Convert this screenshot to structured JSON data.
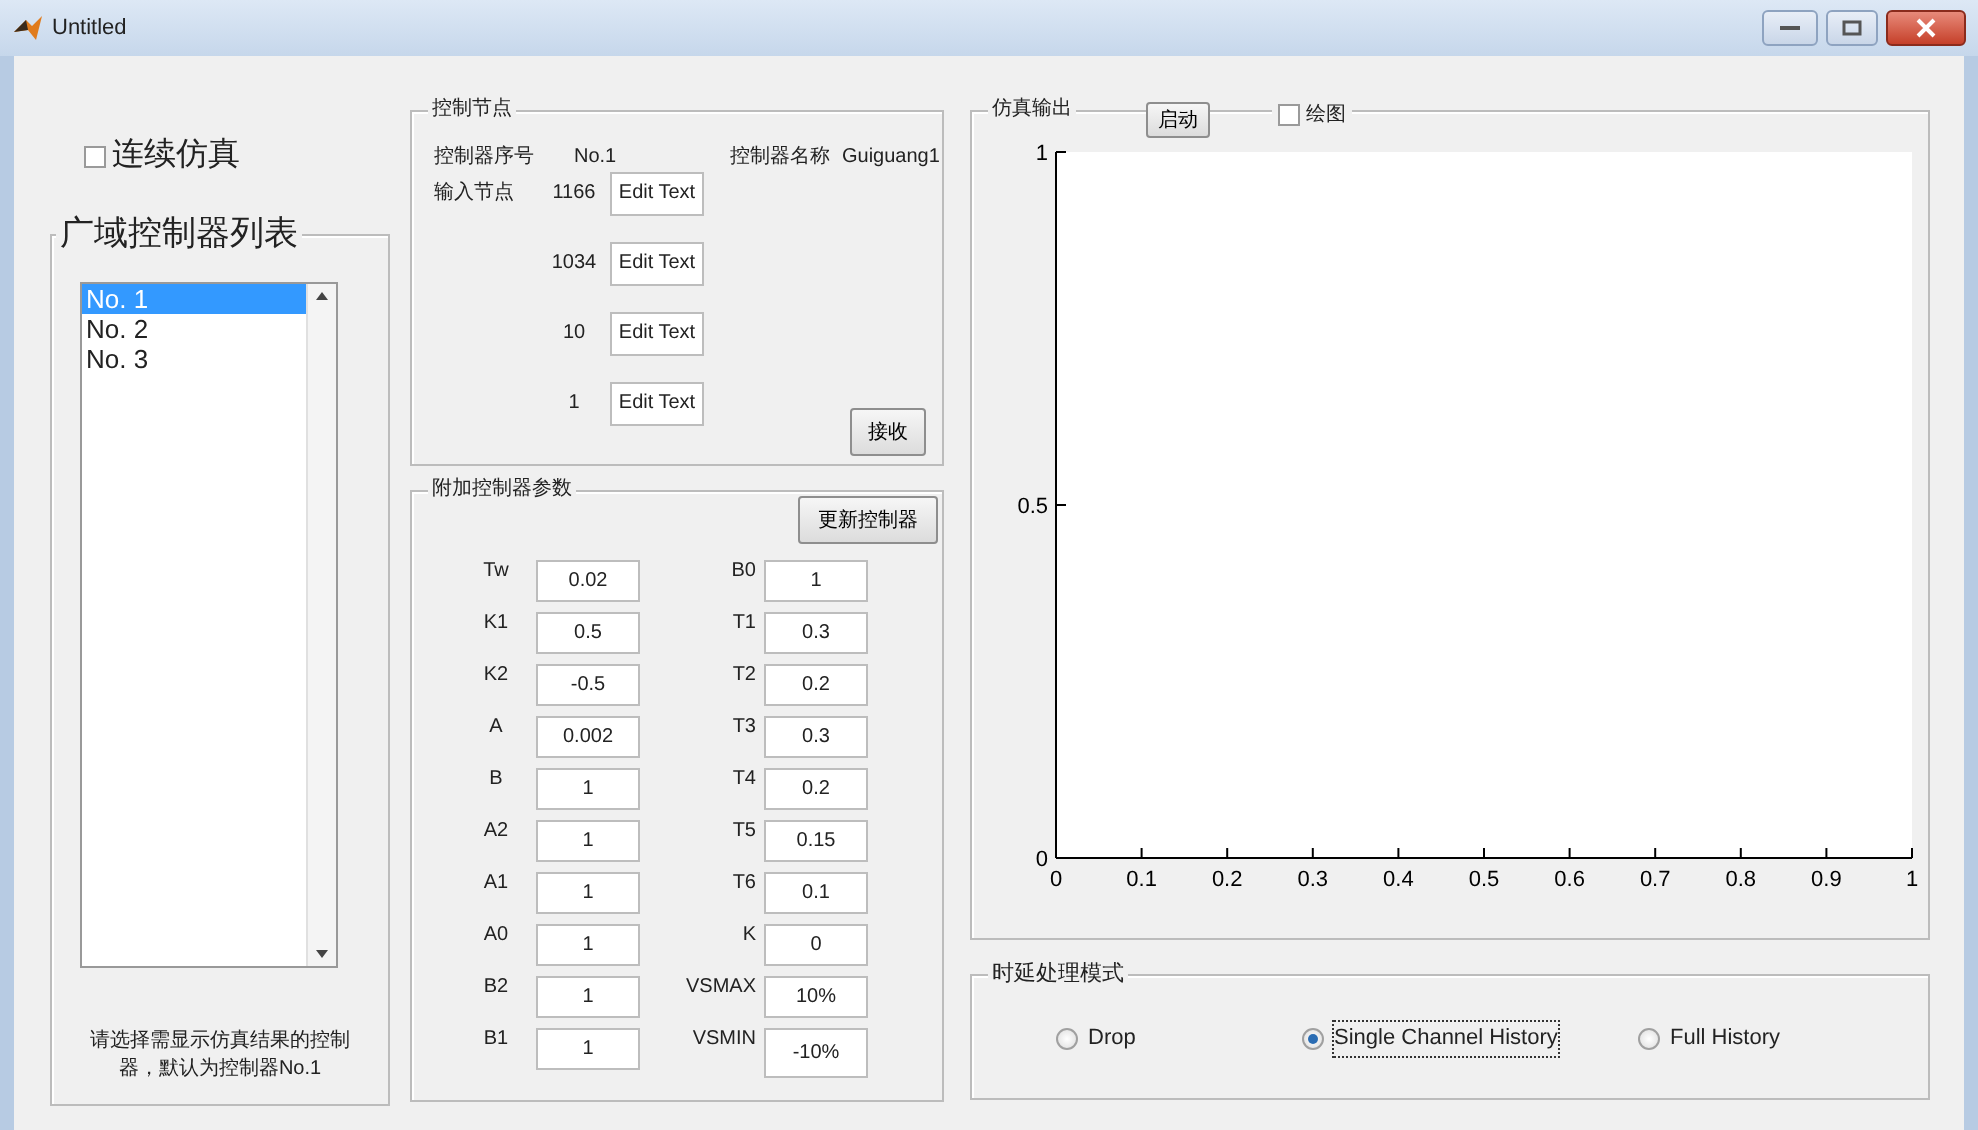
{
  "window": {
    "title": "Untitled"
  },
  "continuous_sim": {
    "label": "连续仿真",
    "checked": false
  },
  "controller_list": {
    "title": "广域控制器列表",
    "items": [
      {
        "label": "No. 1",
        "selected": true
      },
      {
        "label": "No. 2",
        "selected": false
      },
      {
        "label": "No. 3",
        "selected": false
      }
    ],
    "note": "请选择需显示仿真结果的控制器，默认为控制器No.1"
  },
  "control_node": {
    "title": "控制节点",
    "index_label": "控制器序号",
    "index_value": "No.1",
    "name_label": "控制器名称",
    "name_value": "Guiguang1",
    "input_label": "输入节点",
    "inputs": [
      {
        "node": "1166",
        "value": "Edit Text"
      },
      {
        "node": "1034",
        "value": "Edit Text"
      },
      {
        "node": "10",
        "value": "Edit Text"
      },
      {
        "node": "1",
        "value": "Edit Text"
      }
    ],
    "button": "接收"
  },
  "params": {
    "title": "附加控制器参数",
    "button": "更新控制器",
    "rows": [
      {
        "left_label": "Tw",
        "left_value": "0.02",
        "right_label": "B0",
        "right_value": "1"
      },
      {
        "left_label": "K1",
        "left_value": "0.5",
        "right_label": "T1",
        "right_value": "0.3"
      },
      {
        "left_label": "K2",
        "left_value": "-0.5",
        "right_label": "T2",
        "right_value": "0.2"
      },
      {
        "left_label": "A",
        "left_value": "0.002",
        "right_label": "T3",
        "right_value": "0.3"
      },
      {
        "left_label": "B",
        "left_value": "1",
        "right_label": "T4",
        "right_value": "0.2"
      },
      {
        "left_label": "A2",
        "left_value": "1",
        "right_label": "T5",
        "right_value": "0.15"
      },
      {
        "left_label": "A1",
        "left_value": "1",
        "right_label": "T6",
        "right_value": "0.1"
      },
      {
        "left_label": "A0",
        "left_value": "1",
        "right_label": "K",
        "right_value": "0"
      },
      {
        "left_label": "B2",
        "left_value": "1",
        "right_label": "VSMAX",
        "right_value": "10%"
      },
      {
        "left_label": "B1",
        "left_value": "1",
        "right_label": "VSMIN",
        "right_value": "-10%"
      }
    ]
  },
  "output": {
    "title": "仿真输出",
    "button": "启动",
    "plot_checkbox": {
      "label": "绘图",
      "checked": false
    },
    "chart_data": {
      "type": "line",
      "xlim": [
        0,
        1
      ],
      "ylim": [
        0,
        1
      ],
      "xticks": [
        0,
        0.1,
        0.2,
        0.3,
        0.4,
        0.5,
        0.6,
        0.7,
        0.8,
        0.9,
        1
      ],
      "yticks": [
        0,
        0.5,
        1
      ]
    }
  },
  "delay_mode": {
    "title": "时延处理模式",
    "options": [
      {
        "label": "Drop",
        "selected": false
      },
      {
        "label": "Single Channel History",
        "selected": true
      },
      {
        "label": "Full History",
        "selected": false
      }
    ]
  }
}
